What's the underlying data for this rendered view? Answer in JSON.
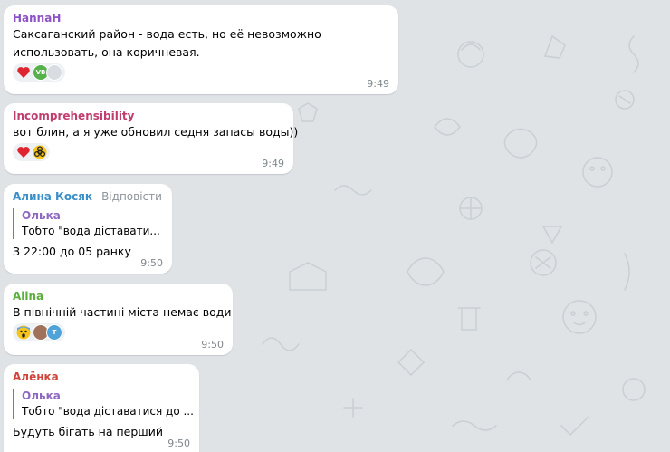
{
  "messages": [
    {
      "author": "HannaH",
      "author_color": "#8e52c6",
      "lines": [
        "Саксаганский район - вода есть, но её невозможно",
        "использовать, она коричневая."
      ],
      "reactions": [
        "heart-icon"
      ],
      "reactor_avatars": [
        "VB",
        ""
      ],
      "time": "9:49"
    },
    {
      "author": "Incomprehensibility",
      "author_color": "#c03d6f",
      "lines": [
        "вот блин, а я уже обновил седня запасы воды))"
      ],
      "reactions": [
        "heart-icon",
        "biohazard-icon"
      ],
      "time": "9:49"
    },
    {
      "author": "Алина Косяк",
      "author_color": "#3a8fc8",
      "reply_action": "Відповісти",
      "quote": {
        "author": "Олька",
        "text": "Тобто \"вода діставати..."
      },
      "lines": [
        "З 22:00 до 05 ранку"
      ],
      "time": "9:50"
    },
    {
      "author": "Alina",
      "author_color": "#5aae3c",
      "lines": [
        "В північній частині міста немає води"
      ],
      "reactions": [
        "scream-icon"
      ],
      "reactor_avatars": [
        "",
        "T"
      ],
      "time": "9:50"
    },
    {
      "author": "Алёнка",
      "author_color": "#d0453b",
      "quote": {
        "author": "Олька",
        "text": "Тобто \"вода діставатися до ..."
      },
      "lines": [
        "Будуть бігать на перший"
      ],
      "time": "9:50"
    }
  ],
  "colors": {
    "background": "#dfe3e6",
    "bubble": "#ffffff",
    "quote_accent": "#8e67c2",
    "time": "#7f878e"
  }
}
